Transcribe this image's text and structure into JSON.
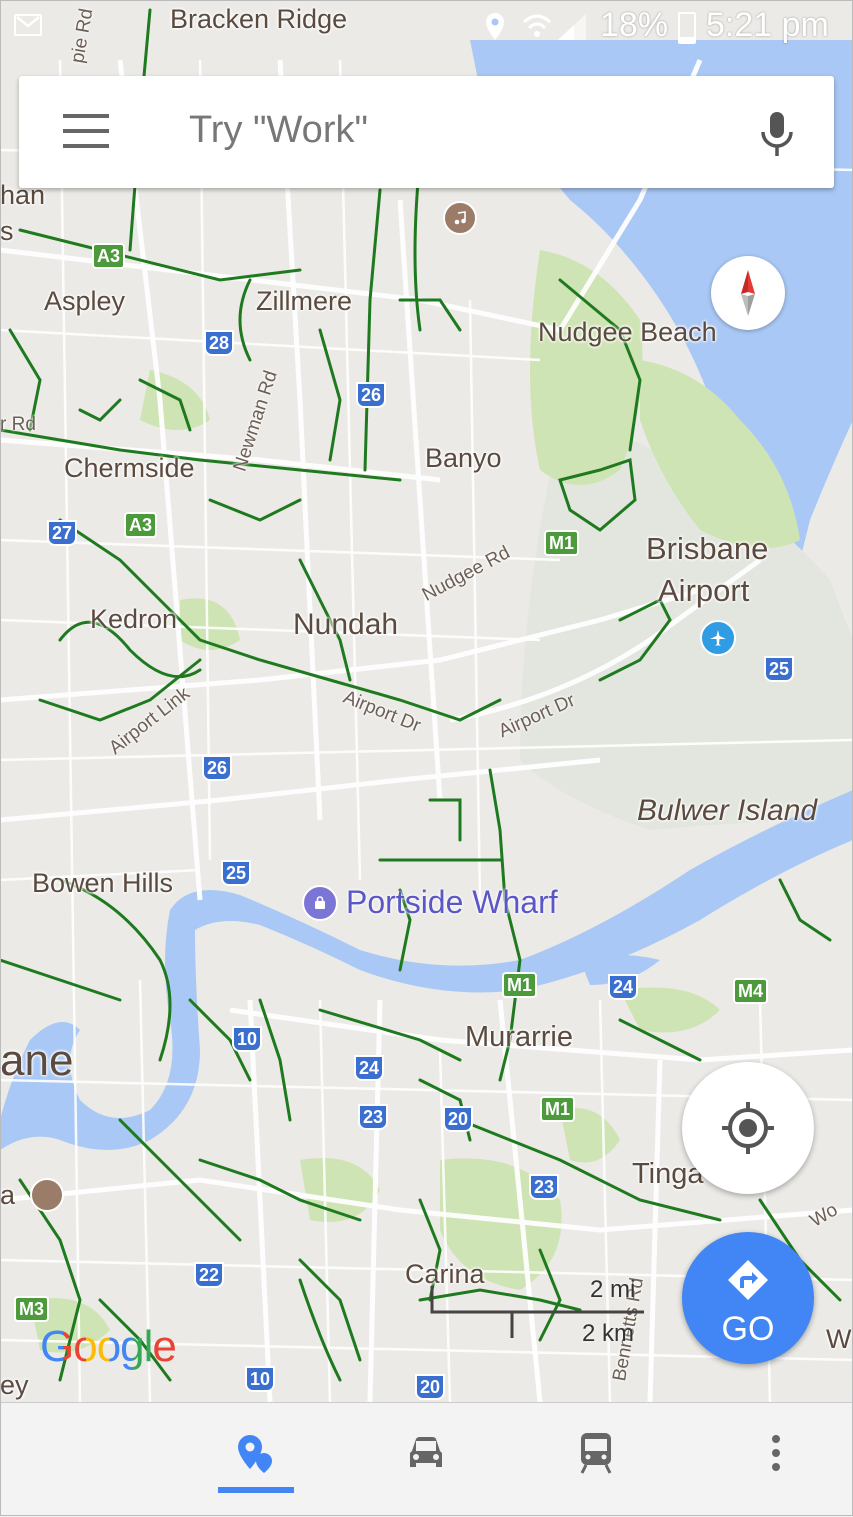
{
  "status_bar": {
    "battery": "18%",
    "time": "5:21 pm"
  },
  "search": {
    "placeholder": "Try \"Work\""
  },
  "map": {
    "places": [
      {
        "id": "bracken-ridge",
        "text": "Bracken Ridge"
      },
      {
        "id": "aspley",
        "text": "Aspley"
      },
      {
        "id": "zillmere",
        "text": "Zillmere"
      },
      {
        "id": "nudgee-beach",
        "text": "Nudgee Beach"
      },
      {
        "id": "banyo",
        "text": "Banyo"
      },
      {
        "id": "chermside",
        "text": "Chermside"
      },
      {
        "id": "brisbane-airport-1",
        "text": "Brisbane"
      },
      {
        "id": "brisbane-airport-2",
        "text": "Airport"
      },
      {
        "id": "kedron",
        "text": "Kedron"
      },
      {
        "id": "nundah",
        "text": "Nundah"
      },
      {
        "id": "bulwer-island",
        "text": "Bulwer Island"
      },
      {
        "id": "bowen-hills",
        "text": "Bowen Hills"
      },
      {
        "id": "murarrie",
        "text": "Murarrie"
      },
      {
        "id": "tingalpa",
        "text": "Tinga"
      },
      {
        "id": "carina",
        "text": "Carina"
      },
      {
        "id": "brisbane-partial",
        "text": "ane"
      },
      {
        "id": "edge-han",
        "text": "han"
      },
      {
        "id": "edge-s",
        "text": "s"
      },
      {
        "id": "edge-ey",
        "text": "ey"
      },
      {
        "id": "edge-a",
        "text": "a"
      },
      {
        "id": "edge-w",
        "text": "W"
      }
    ],
    "roads": [
      {
        "id": "gympie-rd",
        "text": "pie Rd"
      },
      {
        "id": "newman-rd",
        "text": "Newman Rd"
      },
      {
        "id": "nudgee-rd",
        "text": "Nudgee Rd"
      },
      {
        "id": "airport-link",
        "text": "Airport Link"
      },
      {
        "id": "airport-dr-1",
        "text": "Airport Dr"
      },
      {
        "id": "airport-dr-2",
        "text": "Airport Dr"
      },
      {
        "id": "r-rd",
        "text": "r Rd"
      },
      {
        "id": "bennetts-rd",
        "text": "Bennetts Rd"
      },
      {
        "id": "wo-rd",
        "text": "Wo"
      }
    ],
    "poi": {
      "portside": "Portside Wharf"
    },
    "shields": [
      "A3",
      "28",
      "26",
      "27",
      "A3",
      "M1",
      "25",
      "26",
      "25",
      "M1",
      "24",
      "M4",
      "10",
      "24",
      "23",
      "20",
      "M1",
      "23",
      "22",
      "M3",
      "10",
      "20"
    ],
    "scale": {
      "miles": "2 mi",
      "km": "2 km"
    },
    "logo": "Google",
    "colors": {
      "water": "#a9c8f5",
      "park": "#c9e3a6",
      "bike_route": "#1f7a1f",
      "road": "#ffffff",
      "accent": "#4285f4"
    }
  },
  "controls": {
    "go_label": "GO"
  },
  "bottom_nav": {
    "items": [
      "explore-icon",
      "driving-icon",
      "transit-icon",
      "more-icon"
    ],
    "active": "explore-icon"
  }
}
